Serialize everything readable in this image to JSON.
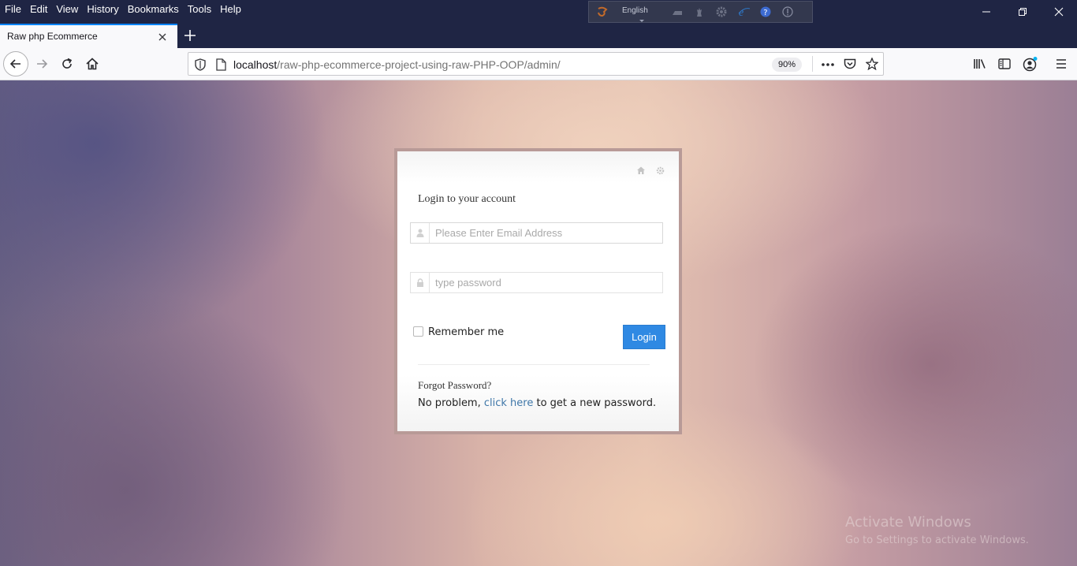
{
  "menu": [
    "File",
    "Edit",
    "View",
    "History",
    "Bookmarks",
    "Tools",
    "Help"
  ],
  "extension_toolbar": {
    "language": "English"
  },
  "tab": {
    "title": "Raw php Ecommerce"
  },
  "urlbar": {
    "host": "localhost",
    "path": "/raw-php-ecommerce-project-using-raw-PHP-OOP/admin/",
    "zoom": "90%"
  },
  "login": {
    "title": "Login to your account",
    "email_placeholder": "Please Enter Email Address",
    "password_placeholder": "type password",
    "remember_label": "Remember me",
    "login_button": "Login",
    "forgot_title": "Forgot Password?",
    "forgot_prefix": "No problem, ",
    "forgot_link": "click here",
    "forgot_suffix": " to get a new password."
  },
  "watermark": {
    "line1": "Activate Windows",
    "line2": "Go to Settings to activate Windows."
  },
  "colors": {
    "chrome_dark": "#1f2544",
    "accent": "#0a84ff",
    "login_button": "#2f89e3"
  },
  "icons": [
    "back-icon",
    "forward-icon",
    "reload-icon",
    "home-icon",
    "shield-icon",
    "page-icon",
    "more-icon",
    "pocket-icon",
    "star-icon",
    "library-icon",
    "sidebar-icon",
    "account-icon",
    "hamburger-menu-icon",
    "user-icon",
    "lock-icon",
    "settings-icon"
  ]
}
